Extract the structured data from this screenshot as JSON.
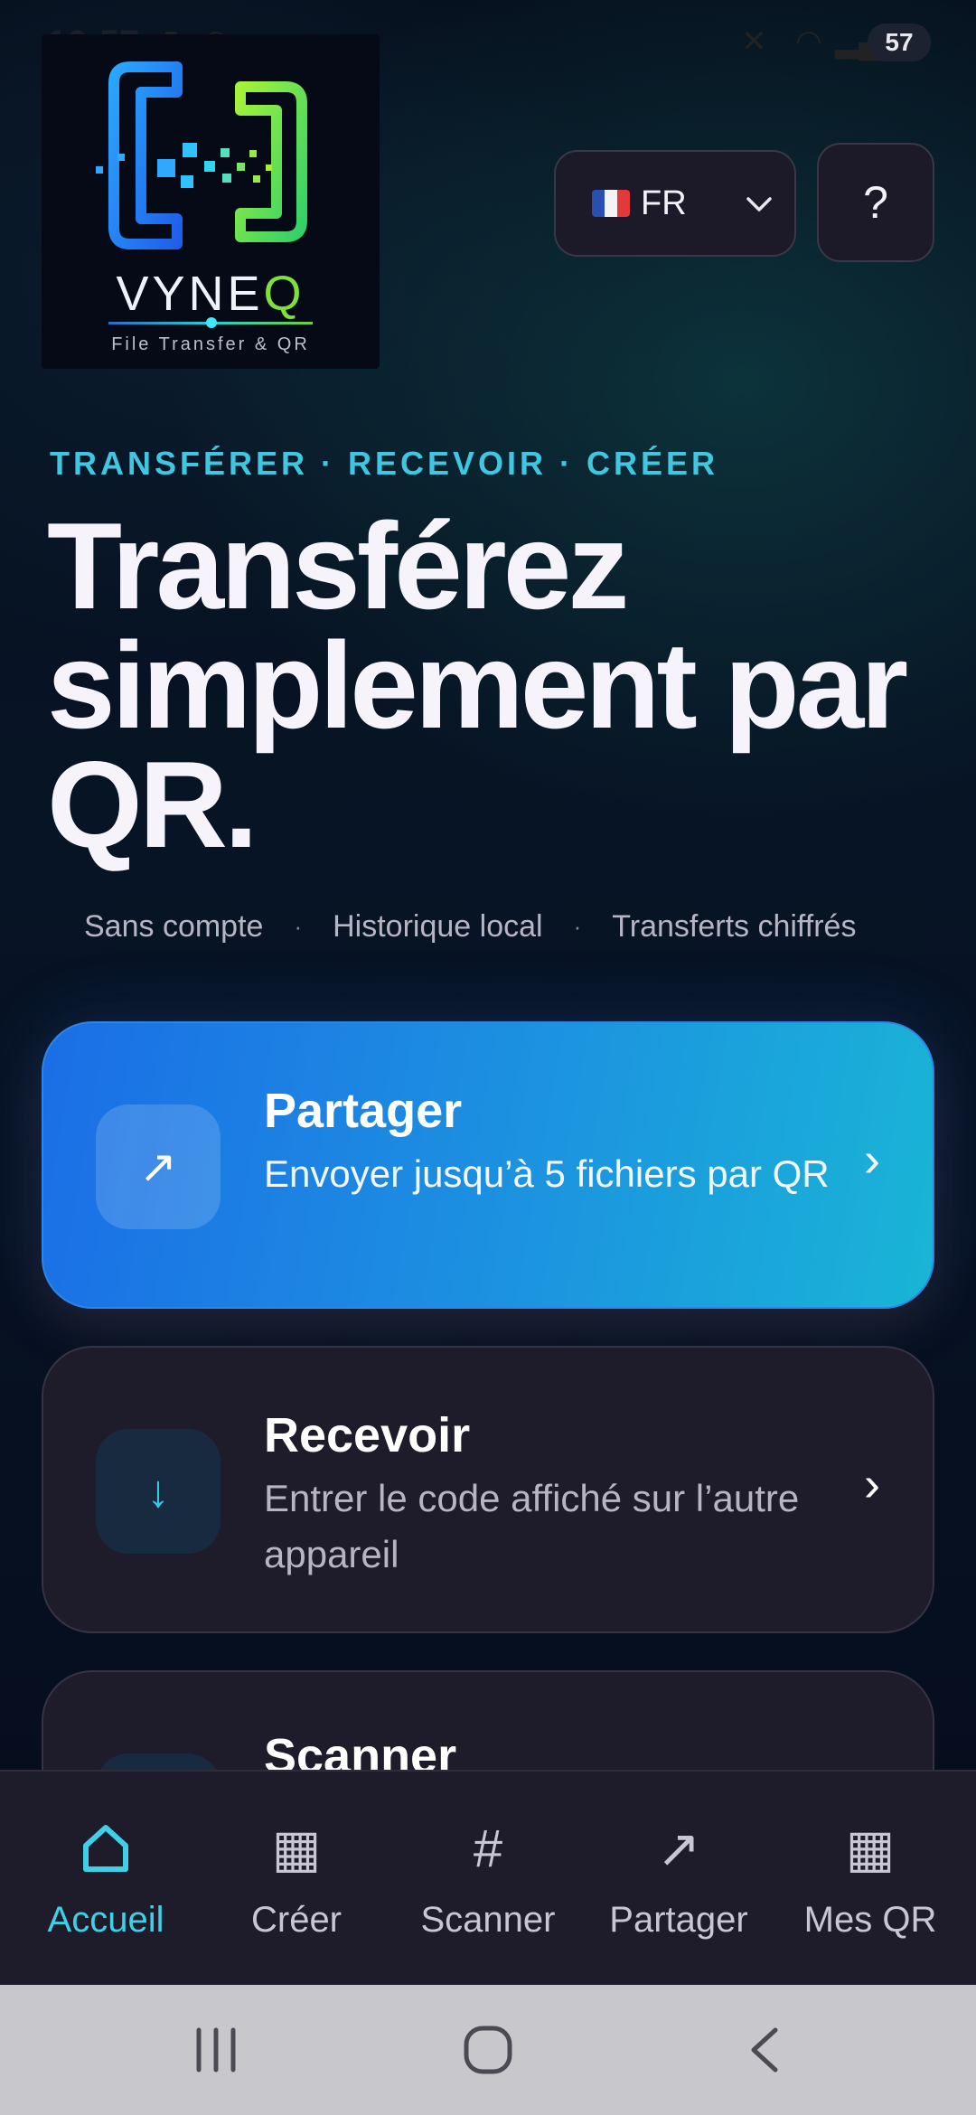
{
  "status_bar": {
    "time": "10:57",
    "battery": "57"
  },
  "logo": {
    "brand_main": "VYNE",
    "brand_accent": "Q",
    "tagline": "File Transfer & QR"
  },
  "header": {
    "language": {
      "code": "FR",
      "flag": "france-flag"
    },
    "help_label": "?"
  },
  "hero": {
    "eyebrow": "TRANSFÉRER · RECEVOIR · CRÉER",
    "headline": "Transférez simplement par QR.",
    "features": [
      "Sans compte",
      "Historique local",
      "Transferts chiffrés"
    ],
    "separator": "·"
  },
  "cards": [
    {
      "title": "Partager",
      "description": "Envoyer jusqu’à 5 fichiers par QR",
      "icon": "arrow-up-right-icon",
      "glyph": "↗",
      "chevron": "›"
    },
    {
      "title": "Recevoir",
      "description": "Entrer le code affiché sur l’autre appareil",
      "icon": "arrow-down-icon",
      "glyph": "↓",
      "chevron": "›"
    },
    {
      "title": "Scanner",
      "description": "",
      "icon": "scan-icon",
      "glyph": "⌗",
      "chevron": "›"
    }
  ],
  "bottom_nav": [
    {
      "label": "Accueil",
      "icon": "home-icon",
      "active": true
    },
    {
      "label": "Créer",
      "icon": "grid-icon",
      "active": false
    },
    {
      "label": "Scanner",
      "icon": "hash-icon",
      "active": false
    },
    {
      "label": "Partager",
      "icon": "arrow-up-right-icon",
      "active": false
    },
    {
      "label": "Mes QR",
      "icon": "grid-icon",
      "active": false
    }
  ],
  "colors": {
    "accent": "#3fd0e8",
    "primary_card_start": "#1b6ee6",
    "primary_card_end": "#19b5d6",
    "surface": "#1e1b2a",
    "background": "#070d1c"
  }
}
